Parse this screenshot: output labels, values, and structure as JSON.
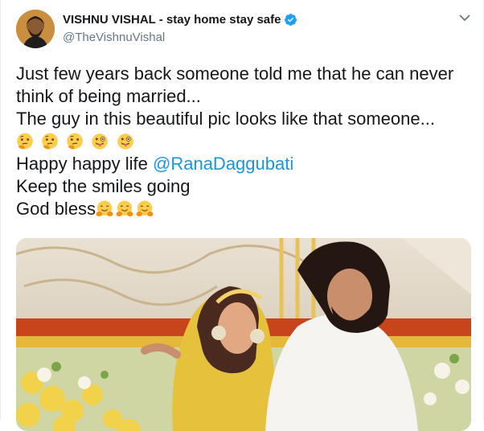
{
  "tweet": {
    "display_name": "VISHNU VISHAL - stay home stay safe",
    "handle": "@TheVishnuVishal",
    "lines": {
      "l1": "Just few years back someone told me that he can never",
      "l2": "think of being married...",
      "l3": "The guy in this beautiful pic looks like that someone...",
      "l5_prefix": "Happy happy life ",
      "mention": "@RanaDaggubati",
      "l6": "Keep the smiles going",
      "l7": "God bless"
    },
    "emojis_row": [
      "thinking-face",
      "thinking-face",
      "thinking-face",
      "winking-face-tongue",
      "winking-face-tongue"
    ],
    "emojis_bless": [
      "hugging-face",
      "hugging-face",
      "hugging-face"
    ]
  },
  "colors": {
    "mention": "#1b95e0",
    "verified": "#1da1f2",
    "handle": "#657786",
    "text": "#14171a"
  }
}
